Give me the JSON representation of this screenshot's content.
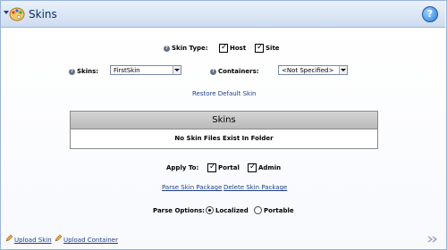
{
  "header": {
    "title": "Skins",
    "collapse_icon": "chevron-down-icon",
    "module_icon": "palette-icon",
    "help_icon": "help-icon"
  },
  "skin_type": {
    "label": "Skin Type:",
    "options": [
      {
        "label": "Host",
        "checked": true
      },
      {
        "label": "Site",
        "checked": true
      }
    ]
  },
  "skins": {
    "label": "Skins:",
    "selected": "FirstSkin"
  },
  "containers": {
    "label": "Containers:",
    "selected": "<Not Specified>"
  },
  "restore_link": "Restore Default Skin",
  "panel": {
    "title": "Skins",
    "message": "No Skin Files Exist In Folder"
  },
  "apply_to": {
    "label": "Apply To:",
    "options": [
      {
        "label": "Portal",
        "checked": true
      },
      {
        "label": "Admin",
        "checked": true
      }
    ]
  },
  "actions": {
    "parse": "Parse Skin Package",
    "delete": "Delete Skin Package"
  },
  "parse_options": {
    "label": "Parse Options:",
    "options": [
      {
        "label": "Localized",
        "selected": true
      },
      {
        "label": "Portable",
        "selected": false
      }
    ]
  },
  "footer": {
    "upload_skin": "Upload Skin",
    "upload_container": "Upload Container"
  }
}
